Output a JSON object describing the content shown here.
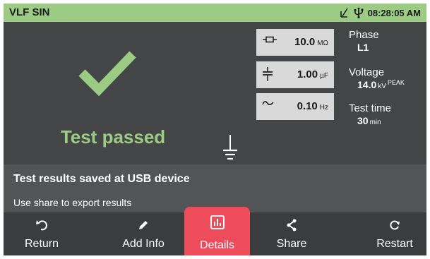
{
  "titlebar": {
    "title": "VLF SIN",
    "time": "08:28:05 AM",
    "icons": [
      "signal-icon",
      "usb-icon"
    ]
  },
  "result": {
    "status": "Test passed",
    "status_color": "#9ccc84",
    "icon": "checkmark-icon"
  },
  "parameters": [
    {
      "icon": "resistor-icon",
      "value": "10.0",
      "unit": "MΩ"
    },
    {
      "icon": "capacitor-icon",
      "value": "1.00",
      "unit": "µF"
    },
    {
      "icon": "sine-wave-icon",
      "value": "0.10",
      "unit": "Hz"
    }
  ],
  "info": {
    "phase_label": "Phase",
    "phase_value": "L1",
    "voltage_label": "Voltage",
    "voltage_value": "14.0",
    "voltage_unit": "kV",
    "voltage_qualifier": "PEAK",
    "time_label": "Test time",
    "time_value": "30",
    "time_unit": "min"
  },
  "message": {
    "title": "Test results saved at USB device",
    "subtitle": "Use share to export results"
  },
  "bottombar": {
    "return_label": "Return",
    "add_info_label": "Add Info",
    "details_label": "Details",
    "share_label": "Share",
    "restart_label": "Restart",
    "active_color": "#ee4b5b"
  }
}
